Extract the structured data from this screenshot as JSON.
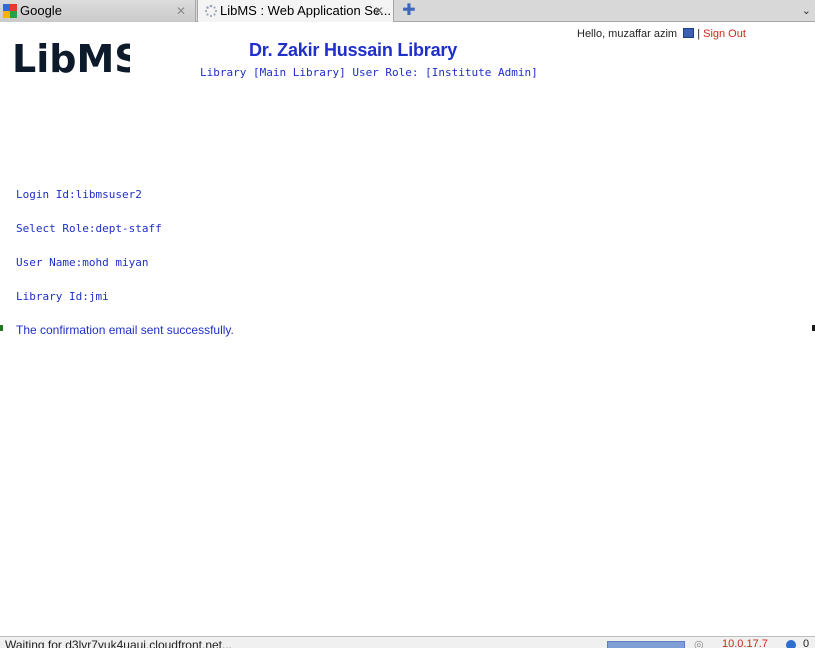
{
  "tabs": [
    {
      "label": "Google",
      "icon": "google-favicon"
    },
    {
      "label": "LibMS : Web Application Se...",
      "icon": "loading-spinner"
    }
  ],
  "tabstrip": {
    "close_glyph": "✕",
    "new_tab_glyph": "✚",
    "menu_glyph": "⌄"
  },
  "header": {
    "logo_text": "LibMS",
    "title": "Dr. Zakir Hussain Library",
    "subtitle": "Library [Main Library]  User Role: [Institute Admin]"
  },
  "userbar": {
    "greeting": "Hello,  muzaffar azim",
    "separator": " | ",
    "signout_label": "Sign Out"
  },
  "details": {
    "login_id": "Login Id:libmsuser2",
    "role": "Select Role:dept-staff",
    "user_name": "User Name:mohd miyan",
    "library_id": "Library Id:jmi"
  },
  "message": "The confirmation email sent successfully.",
  "statusbar": {
    "text": "Waiting for d3lvr7yuk4uaui.cloudfront.net...",
    "ip": "10.0.17.7",
    "count": "0"
  },
  "colors": {
    "accent": "#1f2fc9",
    "signout": "#cc2a1e"
  }
}
